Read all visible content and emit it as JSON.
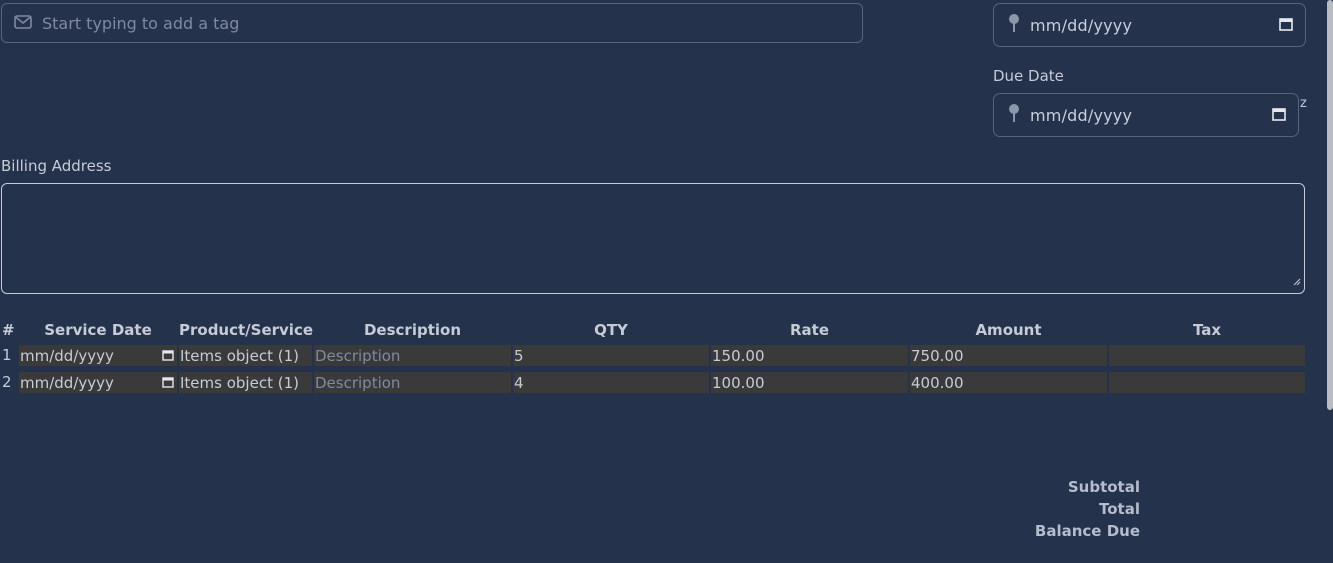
{
  "tags": {
    "placeholder": "Start typing to add a tag",
    "icon": "mail-icon"
  },
  "invoice_date": {
    "value": "mm/dd/yyyy",
    "icon": "pin-icon"
  },
  "due_date": {
    "label": "Due Date",
    "value": "mm/dd/yyyy",
    "icon": "pin-icon",
    "stray_char": "z"
  },
  "billing": {
    "label": "Billing Address",
    "value": ""
  },
  "table": {
    "headers": [
      "#",
      "Service Date",
      "Product/Service",
      "Description",
      "QTY",
      "Rate",
      "Amount",
      "Tax"
    ],
    "rows": [
      {
        "num": "1",
        "service_date": "mm/dd/yyyy",
        "product": "Items object (1)",
        "description": "Description",
        "qty": "5",
        "rate": "150.00",
        "amount": "750.00",
        "tax": ""
      },
      {
        "num": "2",
        "service_date": "mm/dd/yyyy",
        "product": "Items object (1)",
        "description": "Description",
        "qty": "4",
        "rate": "100.00",
        "amount": "400.00",
        "tax": ""
      }
    ]
  },
  "totals": {
    "subtotal": "Subtotal",
    "total": "Total",
    "balance_due": "Balance Due"
  },
  "colors": {
    "background": "#24324c",
    "border": "#56647c",
    "cell": "#3a3a3a",
    "text": "#c6cbd6"
  }
}
